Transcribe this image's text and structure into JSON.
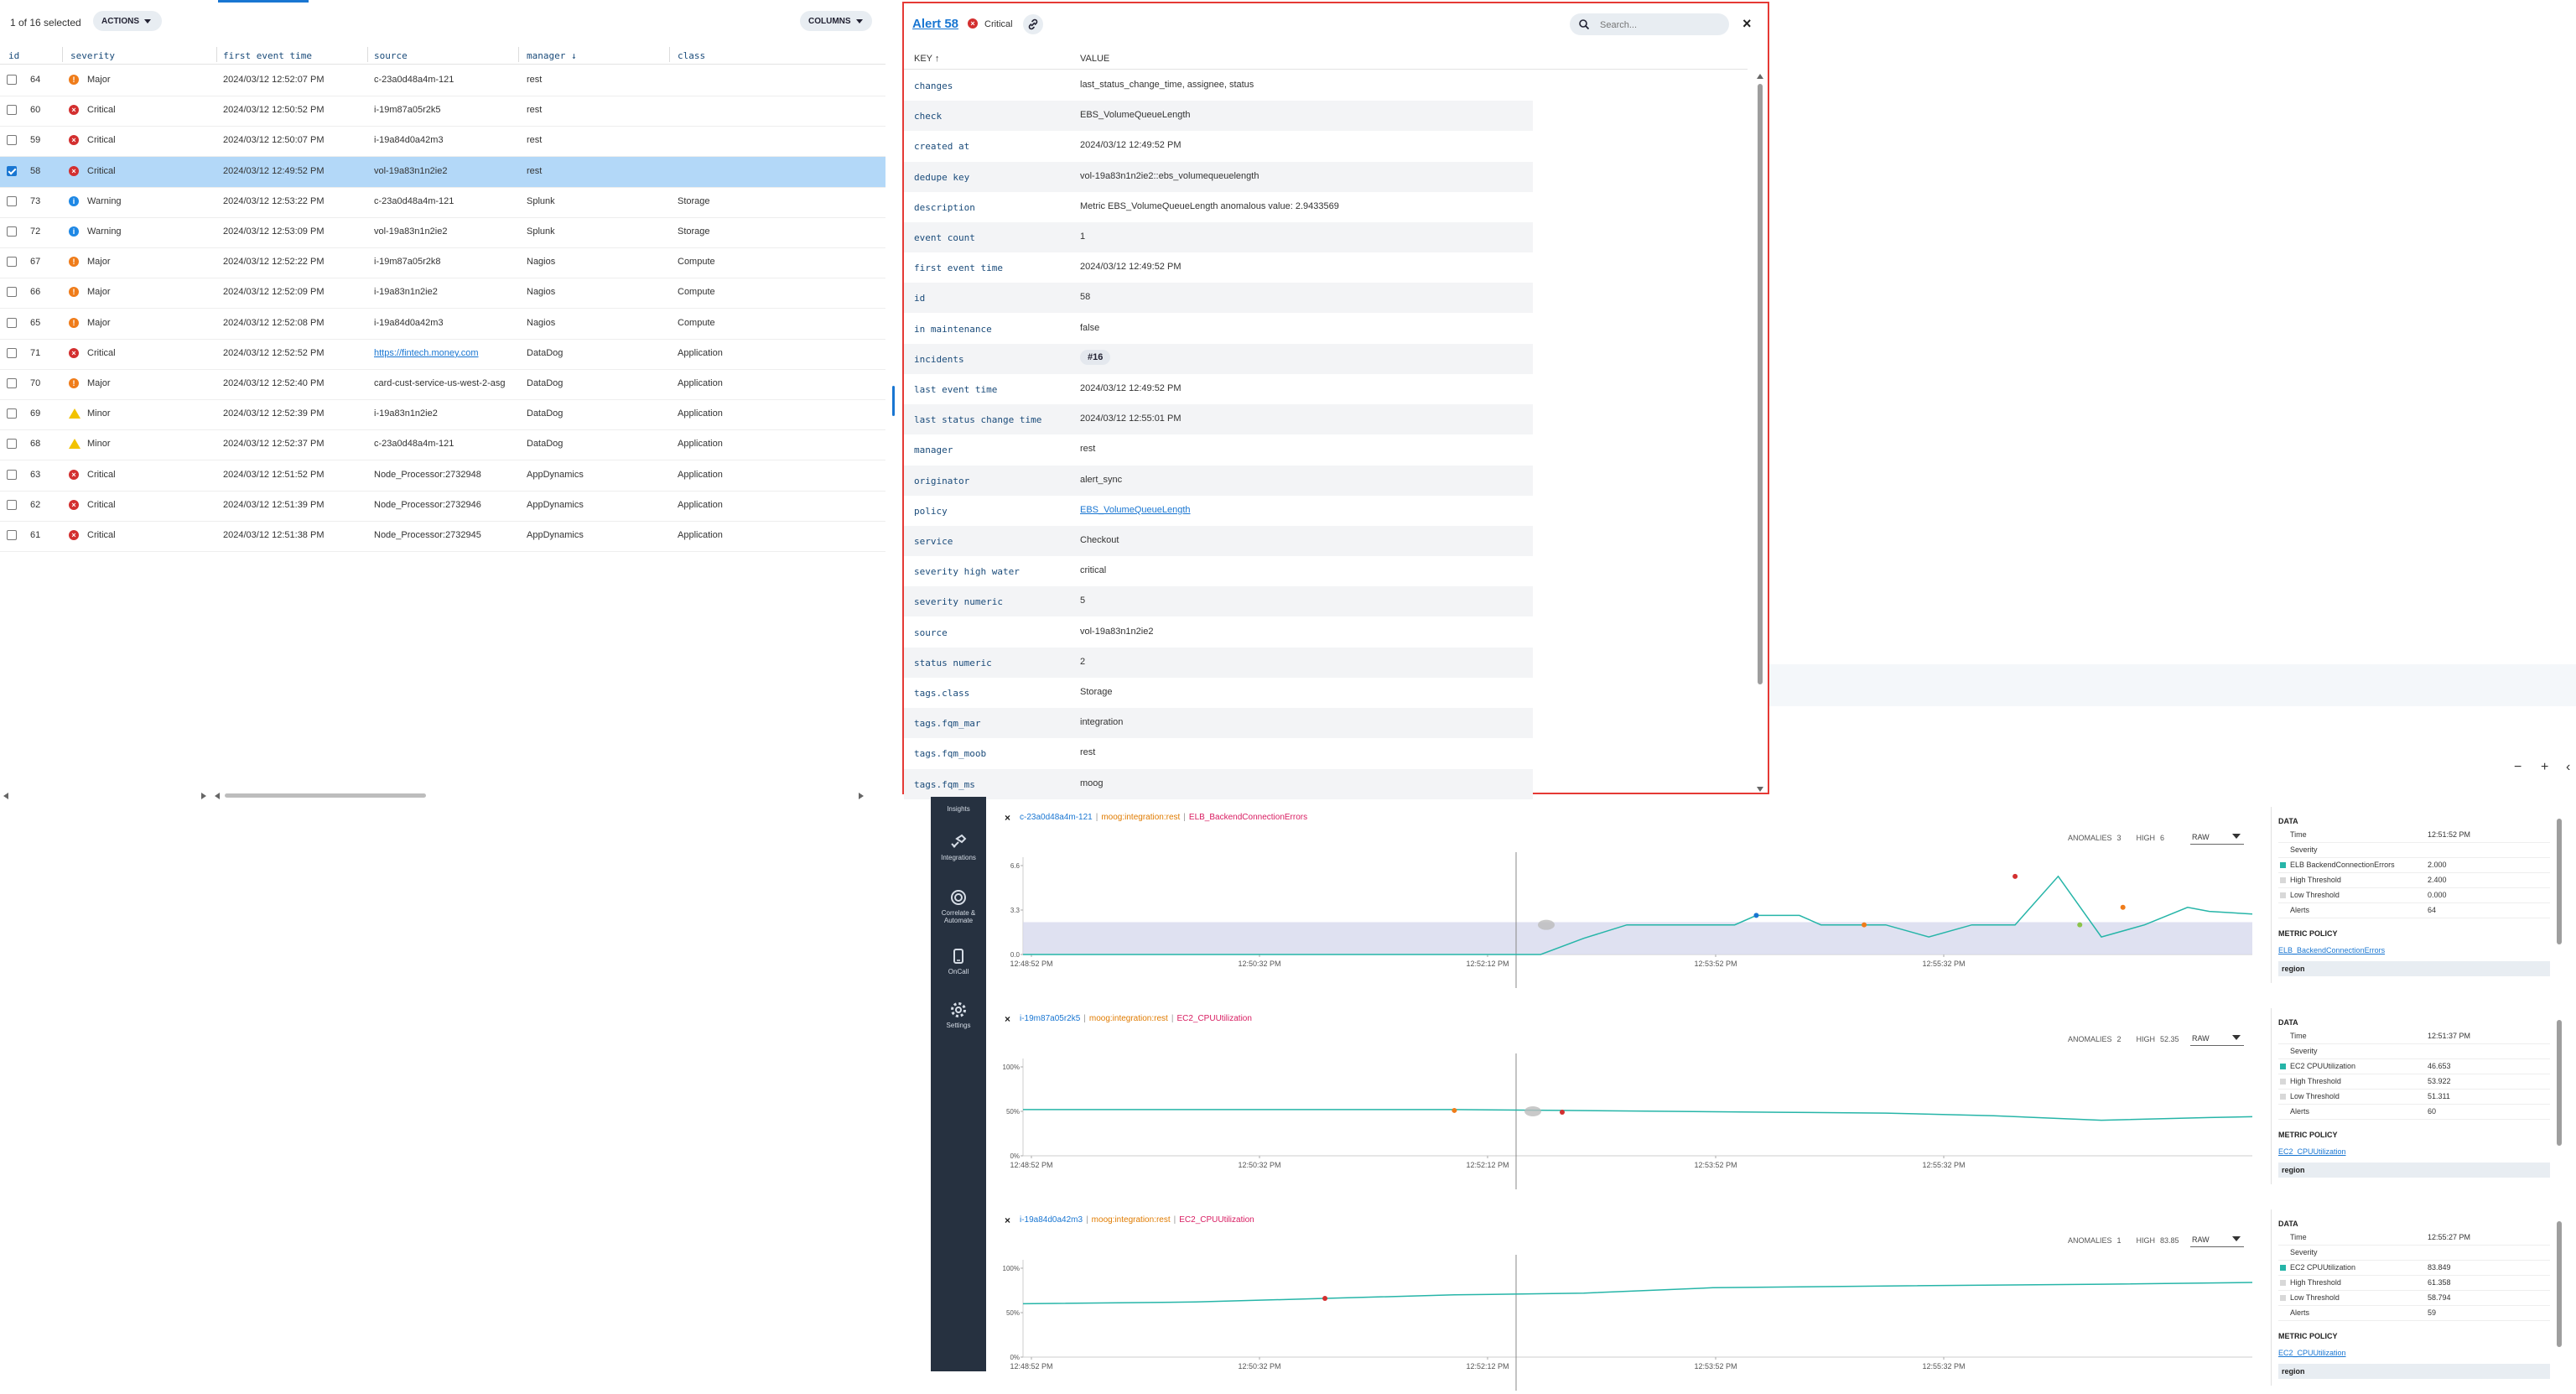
{
  "table": {
    "selection_text": "1 of 16 selected",
    "actions_label": "ACTIONS",
    "columns_label": "COLUMNS",
    "headers": [
      "id",
      "severity",
      "first event time",
      "source",
      "manager ↓",
      "class"
    ],
    "rows": [
      {
        "id": "64",
        "severity": "Major",
        "time": "2024/03/12 12:52:07 PM",
        "source": "c-23a0d48a4m-121",
        "manager": "rest",
        "class": "",
        "selected": false
      },
      {
        "id": "60",
        "severity": "Critical",
        "time": "2024/03/12 12:50:52 PM",
        "source": "i-19m87a05r2k5",
        "manager": "rest",
        "class": "",
        "selected": false
      },
      {
        "id": "59",
        "severity": "Critical",
        "time": "2024/03/12 12:50:07 PM",
        "source": "i-19a84d0a42m3",
        "manager": "rest",
        "class": "",
        "selected": false
      },
      {
        "id": "58",
        "severity": "Critical",
        "time": "2024/03/12 12:49:52 PM",
        "source": "vol-19a83n1n2ie2",
        "manager": "rest",
        "class": "",
        "selected": true
      },
      {
        "id": "73",
        "severity": "Warning",
        "time": "2024/03/12 12:53:22 PM",
        "source": "c-23a0d48a4m-121",
        "manager": "Splunk",
        "class": "Storage",
        "selected": false
      },
      {
        "id": "72",
        "severity": "Warning",
        "time": "2024/03/12 12:53:09 PM",
        "source": "vol-19a83n1n2ie2",
        "manager": "Splunk",
        "class": "Storage",
        "selected": false
      },
      {
        "id": "67",
        "severity": "Major",
        "time": "2024/03/12 12:52:22 PM",
        "source": "i-19m87a05r2k8",
        "manager": "Nagios",
        "class": "Compute",
        "selected": false
      },
      {
        "id": "66",
        "severity": "Major",
        "time": "2024/03/12 12:52:09 PM",
        "source": "i-19a83n1n2ie2",
        "manager": "Nagios",
        "class": "Compute",
        "selected": false
      },
      {
        "id": "65",
        "severity": "Major",
        "time": "2024/03/12 12:52:08 PM",
        "source": "i-19a84d0a42m3",
        "manager": "Nagios",
        "class": "Compute",
        "selected": false
      },
      {
        "id": "71",
        "severity": "Critical",
        "time": "2024/03/12 12:52:52 PM",
        "source": "https://fintech.money.com",
        "manager": "DataDog",
        "class": "Application",
        "selected": false,
        "link": true
      },
      {
        "id": "70",
        "severity": "Major",
        "time": "2024/03/12 12:52:40 PM",
        "source": "card-cust-service-us-west-2-asg",
        "manager": "DataDog",
        "class": "Application",
        "selected": false
      },
      {
        "id": "69",
        "severity": "Minor",
        "time": "2024/03/12 12:52:39 PM",
        "source": "i-19a83n1n2ie2",
        "manager": "DataDog",
        "class": "Application",
        "selected": false
      },
      {
        "id": "68",
        "severity": "Minor",
        "time": "2024/03/12 12:52:37 PM",
        "source": "c-23a0d48a4m-121",
        "manager": "DataDog",
        "class": "Application",
        "selected": false
      },
      {
        "id": "63",
        "severity": "Critical",
        "time": "2024/03/12 12:51:52 PM",
        "source": "Node_Processor:2732948",
        "manager": "AppDynamics",
        "class": "Application",
        "selected": false
      },
      {
        "id": "62",
        "severity": "Critical",
        "time": "2024/03/12 12:51:39 PM",
        "source": "Node_Processor:2732946",
        "manager": "AppDynamics",
        "class": "Application",
        "selected": false
      },
      {
        "id": "61",
        "severity": "Critical",
        "time": "2024/03/12 12:51:38 PM",
        "source": "Node_Processor:2732945",
        "manager": "AppDynamics",
        "class": "Application",
        "selected": false
      }
    ]
  },
  "detail": {
    "title": "Alert 58",
    "severity": "Critical",
    "search_placeholder": "Search...",
    "key_header": "KEY ↑",
    "value_header": "VALUE",
    "fields": [
      {
        "k": "changes",
        "v": "last_status_change_time, assignee, status"
      },
      {
        "k": "check",
        "v": "EBS_VolumeQueueLength"
      },
      {
        "k": "created at",
        "v": "2024/03/12 12:49:52 PM"
      },
      {
        "k": "dedupe key",
        "v": "vol-19a83n1n2ie2::ebs_volumequeuelength"
      },
      {
        "k": "description",
        "v": "Metric EBS_VolumeQueueLength anomalous value: 2.9433569"
      },
      {
        "k": "event count",
        "v": "1"
      },
      {
        "k": "first event time",
        "v": "2024/03/12 12:49:52 PM"
      },
      {
        "k": "id",
        "v": "58"
      },
      {
        "k": "in maintenance",
        "v": "false"
      },
      {
        "k": "incidents",
        "v": "#16",
        "chip": true
      },
      {
        "k": "last event time",
        "v": "2024/03/12 12:49:52 PM"
      },
      {
        "k": "last status change time",
        "v": "2024/03/12 12:55:01 PM"
      },
      {
        "k": "manager",
        "v": "rest"
      },
      {
        "k": "originator",
        "v": "alert_sync"
      },
      {
        "k": "policy",
        "v": "EBS_VolumeQueueLength",
        "link": true
      },
      {
        "k": "service",
        "v": "Checkout"
      },
      {
        "k": "severity high water",
        "v": "critical"
      },
      {
        "k": "severity numeric",
        "v": "5"
      },
      {
        "k": "source",
        "v": "vol-19a83n1n2ie2"
      },
      {
        "k": "status numeric",
        "v": "2"
      },
      {
        "k": "tags.class",
        "v": "Storage"
      },
      {
        "k": "tags.fqm_mar",
        "v": "integration"
      },
      {
        "k": "tags.fqm_moob",
        "v": "rest"
      },
      {
        "k": "tags.fqm_ms",
        "v": "moog"
      }
    ]
  },
  "strip_controls": [
    "−",
    "+",
    "‹"
  ],
  "sidebar": {
    "items": [
      {
        "label": "Insights",
        "icon": "insights-icon"
      },
      {
        "label": "Integrations",
        "icon": "integrations-icon"
      },
      {
        "label": "Correlate & Automate",
        "icon": "correlate-icon"
      },
      {
        "label": "OnCall",
        "icon": "oncall-icon"
      },
      {
        "label": "Settings",
        "icon": "settings-icon"
      }
    ]
  },
  "colors": {
    "accent": "#1976d2",
    "critical": "#d32f2f",
    "major": "#ef7c1a",
    "warning": "#1e88e5",
    "minor": "#f2c200",
    "line": "#26b5a8",
    "band": "#d7d9ee",
    "sidebar": "#263140"
  },
  "chart_data": [
    {
      "type": "line",
      "source": "c-23a0d48a4m-121",
      "manager": "moog:integration:rest",
      "check": "ELB_BackendConnectionErrors",
      "anomalies_label": "ANOMALIES",
      "anomalies": "3",
      "high_label": "HIGH",
      "high": "6",
      "mode": "RAW",
      "y_ticks": [
        "6.6",
        "3.3",
        "0.0"
      ],
      "ylim": [
        0,
        6.6
      ],
      "x_ticks": [
        "12:48:52 PM",
        "12:50:32 PM",
        "12:52:12 PM",
        "12:53:52 PM",
        "12:55:32 PM"
      ],
      "x": [
        0,
        5,
        10,
        15,
        20,
        24,
        26,
        28,
        30,
        32,
        33,
        34,
        35,
        36,
        37,
        37.5,
        38,
        40,
        42,
        44,
        45,
        46,
        48,
        50,
        52,
        54,
        55,
        57
      ],
      "y": [
        0.0,
        0.0,
        0.0,
        0.0,
        0.0,
        0.0,
        1.2,
        2.2,
        2.2,
        2.2,
        2.2,
        2.9,
        2.9,
        2.9,
        2.2,
        2.2,
        2.2,
        2.2,
        1.3,
        2.2,
        2.2,
        2.2,
        5.8,
        1.3,
        2.2,
        3.5,
        3.2,
        3.0
      ],
      "band": [
        0,
        2.4
      ],
      "anomaly_points": [
        {
          "x": 34,
          "y": 2.9,
          "c": "#1976d2"
        },
        {
          "x": 39,
          "y": 2.2,
          "c": "#ef7c1a"
        },
        {
          "x": 46,
          "y": 5.8,
          "c": "#d32f2f"
        },
        {
          "x": 49,
          "y": 2.2,
          "c": "#8bc34a"
        },
        {
          "x": 51,
          "y": 3.5,
          "c": "#ef7c1a"
        }
      ],
      "data": {
        "title": "DATA",
        "time_label": "Time",
        "time": "12:51:52 PM",
        "severity_label": "Severity",
        "rows": [
          {
            "l": "ELB BackendConnectionErrors",
            "r": "2.000",
            "c": "#26b5a8"
          },
          {
            "l": "High Threshold",
            "r": "2.400",
            "c": "#d8d8d8"
          },
          {
            "l": "Low Threshold",
            "r": "0.000",
            "c": "#d8d8d8"
          },
          {
            "l": "Alerts",
            "r": "64",
            "c": ""
          }
        ],
        "policy_label": "METRIC POLICY",
        "policy": "ELB_BackendConnectionErrors",
        "region": "region"
      }
    },
    {
      "type": "line",
      "source": "i-19m87a05r2k5",
      "manager": "moog:integration:rest",
      "check": "EC2_CPUUtilization",
      "anomalies_label": "ANOMALIES",
      "anomalies": "2",
      "high_label": "HIGH",
      "high": "52.35",
      "mode": "RAW",
      "y_ticks": [
        "100%",
        "50%",
        "0%"
      ],
      "ylim": [
        0,
        100
      ],
      "x_ticks": [
        "12:48:52 PM",
        "12:50:32 PM",
        "12:52:12 PM",
        "12:53:52 PM",
        "12:55:32 PM"
      ],
      "x": [
        0,
        10,
        20,
        25,
        30,
        35,
        40,
        45,
        50,
        55,
        57
      ],
      "y": [
        52,
        52,
        52,
        51,
        50,
        49,
        48,
        45,
        40,
        43,
        44
      ],
      "band": null,
      "anomaly_points": [
        {
          "x": 20,
          "y": 51,
          "c": "#ef7c1a"
        },
        {
          "x": 25,
          "y": 49,
          "c": "#d32f2f"
        }
      ],
      "data": {
        "title": "DATA",
        "time_label": "Time",
        "time": "12:51:37 PM",
        "severity_label": "Severity",
        "rows": [
          {
            "l": "EC2 CPUUtilization",
            "r": "46.653",
            "c": "#26b5a8"
          },
          {
            "l": "High Threshold",
            "r": "53.922",
            "c": "#d8d8d8"
          },
          {
            "l": "Low Threshold",
            "r": "51.311",
            "c": "#d8d8d8"
          },
          {
            "l": "Alerts",
            "r": "60",
            "c": ""
          }
        ],
        "policy_label": "METRIC POLICY",
        "policy": "EC2_CPUUtilization",
        "region": "region"
      }
    },
    {
      "type": "line",
      "source": "i-19a84d0a42m3",
      "manager": "moog:integration:rest",
      "check": "EC2_CPUUtilization",
      "anomalies_label": "ANOMALIES",
      "anomalies": "1",
      "high_label": "HIGH",
      "high": "83.85",
      "mode": "RAW",
      "y_ticks": [
        "100%",
        "50%",
        "0%"
      ],
      "ylim": [
        0,
        100
      ],
      "x_ticks": [
        "12:48:52 PM",
        "12:50:32 PM",
        "12:52:12 PM",
        "12:53:52 PM",
        "12:55:32 PM"
      ],
      "x": [
        0,
        8,
        14,
        20,
        26,
        32,
        40,
        50,
        57
      ],
      "y": [
        60,
        62,
        66,
        70,
        72,
        78,
        80,
        82,
        84
      ],
      "band": null,
      "anomaly_points": [
        {
          "x": 14,
          "y": 66,
          "c": "#d32f2f"
        }
      ],
      "data": {
        "title": "DATA",
        "time_label": "Time",
        "time": "12:55:27 PM",
        "severity_label": "Severity",
        "rows": [
          {
            "l": "EC2 CPUUtilization",
            "r": "83.849",
            "c": "#26b5a8"
          },
          {
            "l": "High Threshold",
            "r": "61.358",
            "c": "#d8d8d8"
          },
          {
            "l": "Low Threshold",
            "r": "58.794",
            "c": "#d8d8d8"
          },
          {
            "l": "Alerts",
            "r": "59",
            "c": ""
          }
        ],
        "policy_label": "METRIC POLICY",
        "policy": "EC2_CPUUtilization",
        "region": "region"
      }
    }
  ]
}
